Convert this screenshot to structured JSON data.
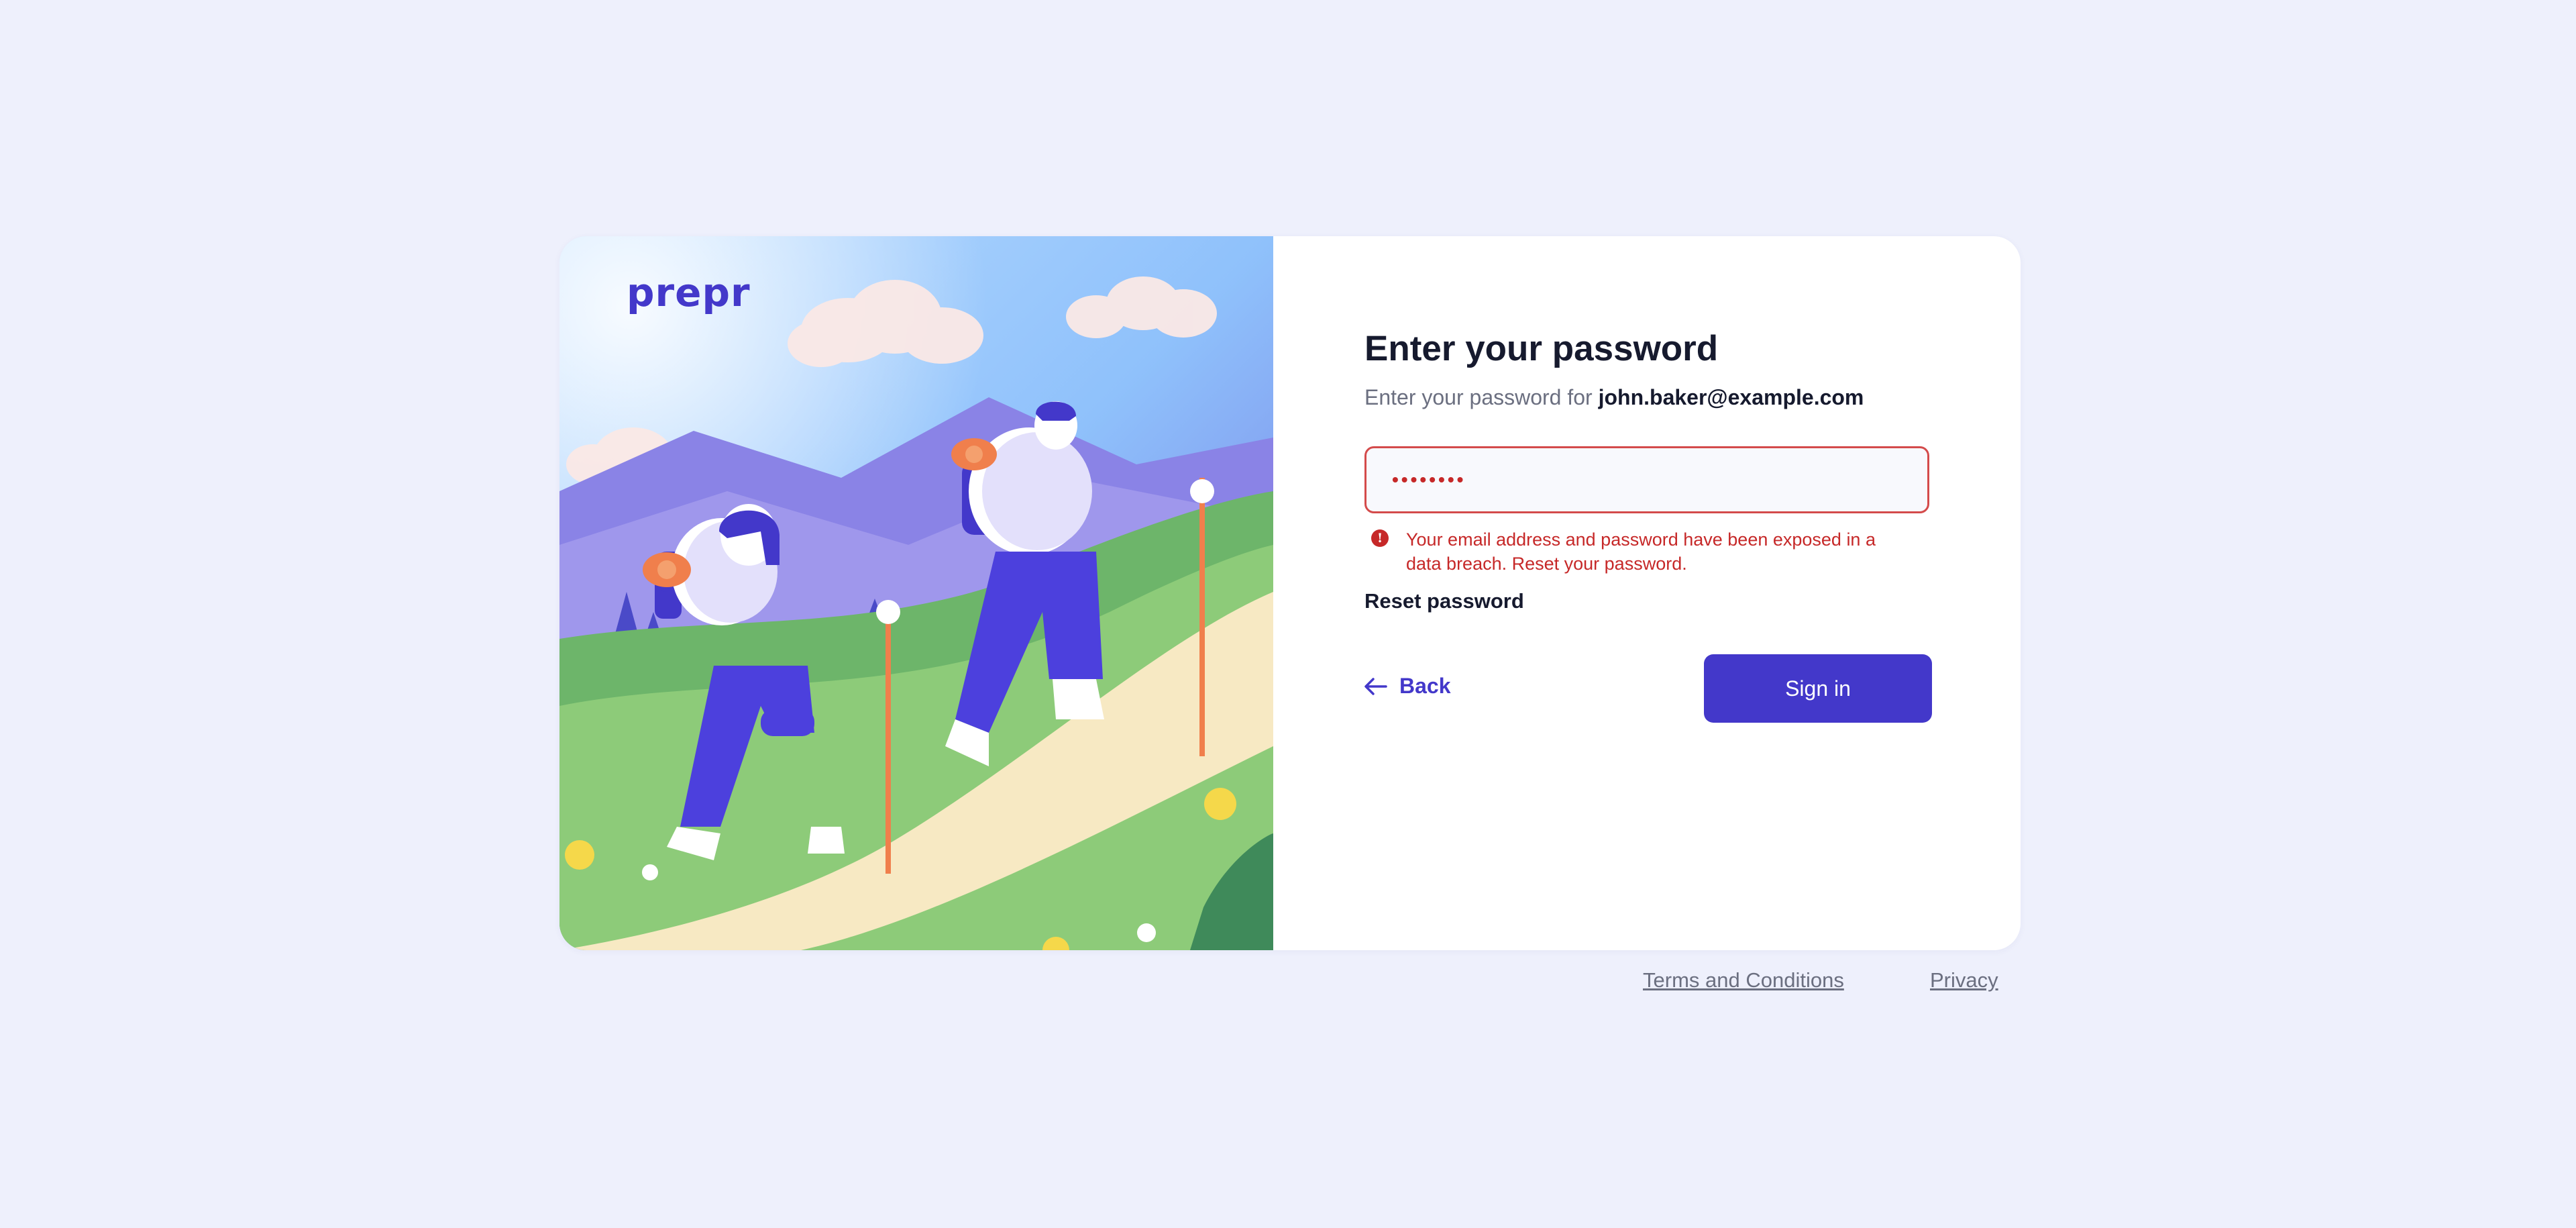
{
  "brand": {
    "logo_text": "prepr",
    "accent_color": "#4338ca",
    "error_color": "#c62828"
  },
  "form": {
    "title": "Enter your password",
    "subtitle_prefix": "Enter your password for",
    "email": "john.baker@example.com",
    "password_masked": "••••••••",
    "error_message": "Your email address and password have been exposed in a data breach. Reset your password.",
    "reset_label": "Reset password",
    "back_label": "Back",
    "signin_label": "Sign in"
  },
  "icons": {
    "error": "alert-circle-icon",
    "back": "arrow-left-icon"
  },
  "footer": {
    "terms_label": "Terms and Conditions",
    "privacy_label": "Privacy"
  }
}
